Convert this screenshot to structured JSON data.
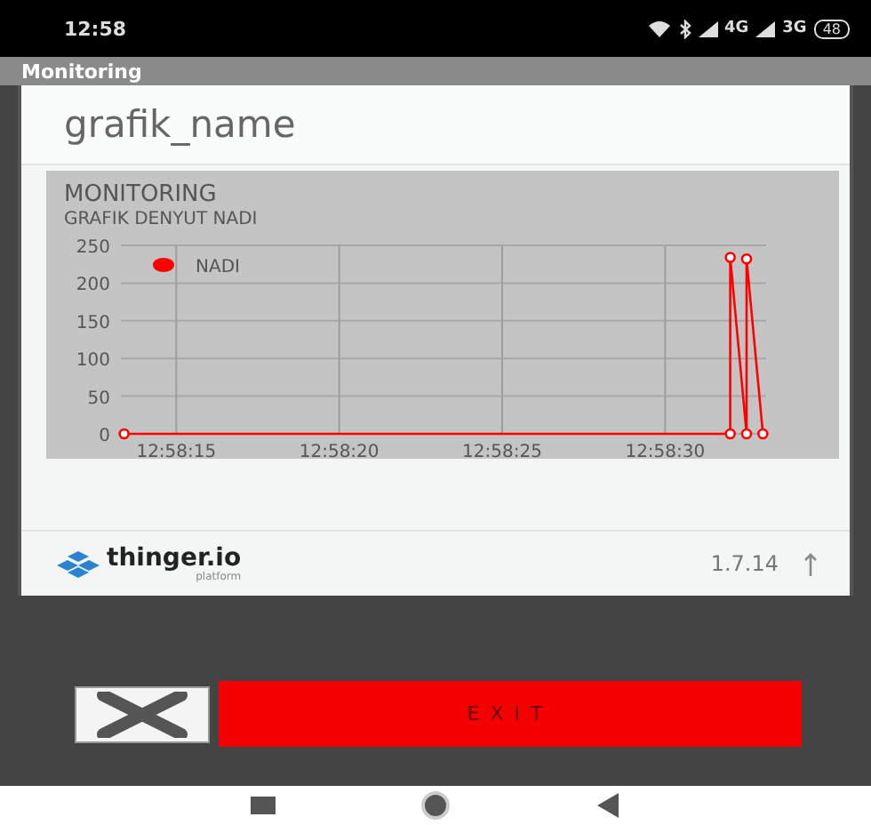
{
  "status_bar": {
    "time": "12:58",
    "network_1": "4G",
    "network_2": "3G",
    "battery": "48"
  },
  "app_bar": {
    "title": "Monitoring"
  },
  "dashboard": {
    "title": "grafik_name",
    "widget": {
      "title": "MONITORING",
      "subtitle": "GRAFIK DENYUT NADI",
      "chart_data": {
        "type": "line",
        "x": [
          46693.4,
          46712.0,
          46712.0,
          46712.5,
          46712.5,
          46713.0
        ],
        "grid": true,
        "series": [
          {
            "name": "NADI",
            "color": "#ff0000",
            "marker": "circle",
            "values": [
              0,
              0,
              234,
              0,
              232,
              0
            ]
          }
        ],
        "xlim": [
          46693.3,
          46713.1
        ],
        "ylim": [
          0,
          250
        ],
        "xticks": [
          {
            "value": 46695,
            "label": "12:58:15"
          },
          {
            "value": 46700,
            "label": "12:58:20"
          },
          {
            "value": 46705,
            "label": "12:58:25"
          },
          {
            "value": 46710,
            "label": "12:58:30"
          }
        ],
        "yticks": [
          0,
          50,
          100,
          150,
          200,
          250
        ]
      }
    }
  },
  "footer": {
    "brand": "thinger.io",
    "brand_sub": "platform",
    "version": "1.7.14"
  },
  "exit_button": {
    "label": "EXIT"
  }
}
